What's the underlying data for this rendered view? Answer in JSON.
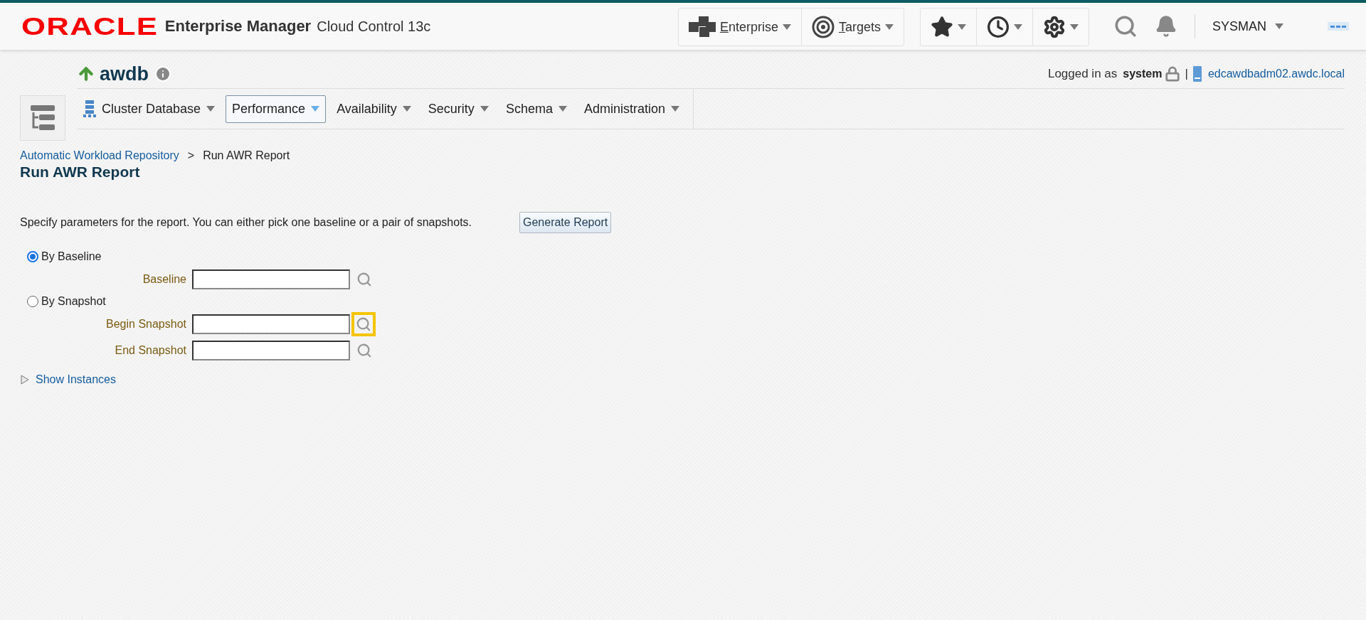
{
  "header": {
    "logo": "ORACLE",
    "product": "Enterprise Manager",
    "edition": "Cloud Control 13c",
    "menus": [
      {
        "label": "Enterprise",
        "underline_first": true
      },
      {
        "label": "Targets",
        "underline_first": true
      }
    ],
    "user": "SYSMAN"
  },
  "target": {
    "name": "awdb",
    "status_up": true,
    "logged_in_label": "Logged in as",
    "user": "system",
    "separator": "|",
    "host": "edcawdbadm02.awdc.local",
    "nav": [
      {
        "label": "Cluster Database",
        "selected": false,
        "has_icon": true
      },
      {
        "label": "Performance",
        "selected": true,
        "has_icon": false
      },
      {
        "label": "Availability",
        "selected": false,
        "has_icon": false
      },
      {
        "label": "Security",
        "selected": false,
        "has_icon": false
      },
      {
        "label": "Schema",
        "selected": false,
        "has_icon": false
      },
      {
        "label": "Administration",
        "selected": false,
        "has_icon": false
      }
    ]
  },
  "breadcrumb": [
    {
      "label": "Automatic Workload Repository",
      "link": true
    },
    {
      "label": ">",
      "link": false
    },
    {
      "label": "Run AWR Report",
      "link": false
    }
  ],
  "title": "Run AWR Report",
  "instructions": "Specify parameters for the report. You can either pick one baseline or a pair of snapshots.",
  "generate_button": "Generate Report",
  "options": [
    {
      "label": "By Baseline",
      "selected": true,
      "fields": [
        {
          "label": "Baseline",
          "lookup_focused": false
        }
      ]
    },
    {
      "label": "By Snapshot",
      "selected": false,
      "fields": [
        {
          "label": "Begin Snapshot",
          "lookup_focused": true
        },
        {
          "label": "End Snapshot",
          "lookup_focused": false
        }
      ]
    }
  ],
  "show_instances": {
    "label": "Show Instances",
    "expanded": false
  }
}
